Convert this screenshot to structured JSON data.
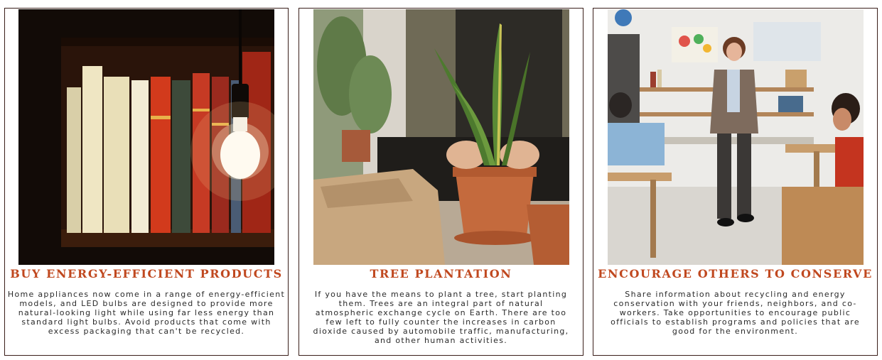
{
  "cards": [
    {
      "title": "BUY ENERGY-EFFICIENT PRODUCTS",
      "text": "Home appliances now come in a range of energy-efficient models, and LED bulbs are designed to provide more natural-looking light while using far less energy than standard light bulbs. Avoid products that come with excess packaging that can't be recycled.",
      "image": "bookshelf-with-light-bulb"
    },
    {
      "title": "TREE PLANTATION",
      "text": "If you have the means to plant a tree, start planting them. Trees are an integral part of natural atmospheric exchange cycle on Earth. There are too few left to fully counter the increases in carbon dioxide caused by automobile traffic, manufacturing, and other human activities.",
      "image": "person-potting-snake-plant"
    },
    {
      "title": "ENCOURAGE OTHERS TO CONSERVE",
      "text": "Share information about recycling and energy conservation with your friends, neighbors, and co-workers. Take opportunities to encourage public officials to establish programs and policies that are good for the environment.",
      "image": "teacher-in-classroom"
    }
  ],
  "colors": {
    "title": "#c0481f",
    "text": "#2a2a2a",
    "border": "#3a1f1a"
  }
}
